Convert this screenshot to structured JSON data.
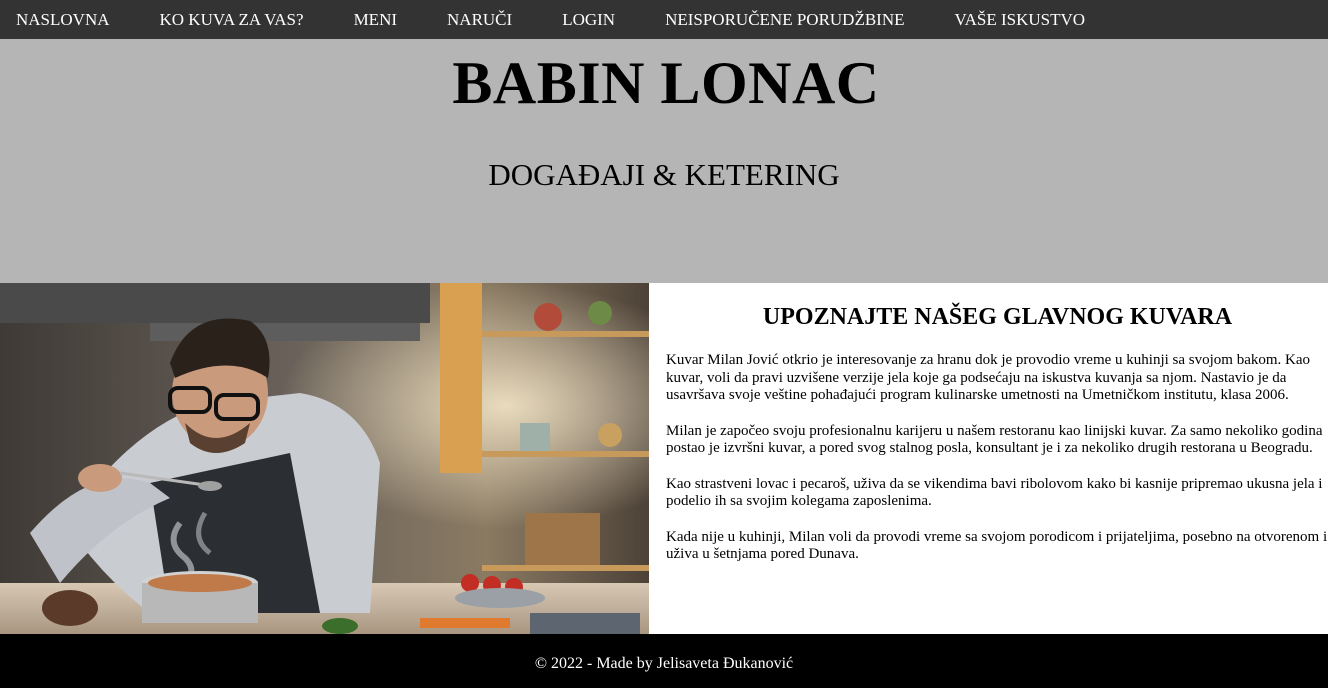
{
  "nav": {
    "items": [
      {
        "label": "NASLOVNA"
      },
      {
        "label": "KO KUVA ZA VAS?"
      },
      {
        "label": "MENI"
      },
      {
        "label": "NARUČI"
      },
      {
        "label": "LOGIN"
      },
      {
        "label": "NEISPORUČENE PORUDŽBINE"
      },
      {
        "label": "VAŠE ISKUSTVO"
      }
    ]
  },
  "header": {
    "title": "BABIN LONAC",
    "subtitle": "DOGAĐAJI & KETERING"
  },
  "main": {
    "heading": "UPOZNAJTE NAŠEG GLAVNOG KUVARA",
    "paragraphs": [
      "Kuvar Milan Jović otkrio je interesovanje za hranu dok je provodio vreme u kuhinji sa svojom bakom. Kao kuvar, voli da pravi uzvišene verzije jela koje ga podsećaju na iskustva kuvanja sa njom. Nastavio je da usavršava svoje veštine pohađajući program kulinarske umetnosti na Umetničkom institutu, klasa 2006.",
      "Milan je započeo svoju profesionalnu karijeru u našem restoranu kao linijski kuvar. Za samo nekoliko godina postao je izvršni kuvar, a pored svog stalnog posla, konsultant je i za nekoliko drugih restorana u Beogradu.",
      "Kao strastveni lovac i pecaroš, uživa da se vikendima bavi ribolovom kako bi kasnije pripremao ukusna jela i podelio ih sa svojim kolegama zaposlenima.",
      "Kada nije u kuhinji, Milan voli da provodi vreme sa svojom porodicom i prijateljima, posebno na otvorenom i uživa u šetnjama pored Dunava."
    ]
  },
  "footer": {
    "text": "© 2022 - Made by Jelisaveta Đukanović"
  },
  "colors": {
    "nav_bg": "#333333",
    "header_bg": "#b5b5b5",
    "footer_bg": "#000000"
  }
}
